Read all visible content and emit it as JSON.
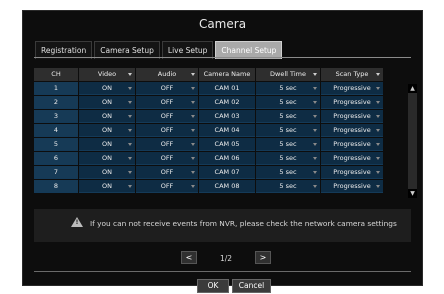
{
  "window": {
    "title": "Camera"
  },
  "tabs": [
    {
      "label": "Registration",
      "active": false
    },
    {
      "label": "Camera Setup",
      "active": false
    },
    {
      "label": "Live Setup",
      "active": false
    },
    {
      "label": "Channel Setup",
      "active": true
    }
  ],
  "table": {
    "headers": [
      "CH",
      "Video",
      "Audio",
      "Camera Name",
      "Dwell Time",
      "Scan Type"
    ],
    "rows": [
      {
        "ch": "1",
        "video": "ON",
        "audio": "OFF",
        "name": "CAM 01",
        "dwell": "5 sec",
        "scan": "Progressive"
      },
      {
        "ch": "2",
        "video": "ON",
        "audio": "OFF",
        "name": "CAM 02",
        "dwell": "5 sec",
        "scan": "Progressive"
      },
      {
        "ch": "3",
        "video": "ON",
        "audio": "OFF",
        "name": "CAM 03",
        "dwell": "5 sec",
        "scan": "Progressive"
      },
      {
        "ch": "4",
        "video": "ON",
        "audio": "OFF",
        "name": "CAM 04",
        "dwell": "5 sec",
        "scan": "Progressive"
      },
      {
        "ch": "5",
        "video": "ON",
        "audio": "OFF",
        "name": "CAM 05",
        "dwell": "5 sec",
        "scan": "Progressive"
      },
      {
        "ch": "6",
        "video": "ON",
        "audio": "OFF",
        "name": "CAM 06",
        "dwell": "5 sec",
        "scan": "Progressive"
      },
      {
        "ch": "7",
        "video": "ON",
        "audio": "OFF",
        "name": "CAM 07",
        "dwell": "5 sec",
        "scan": "Progressive"
      },
      {
        "ch": "8",
        "video": "ON",
        "audio": "OFF",
        "name": "CAM 08",
        "dwell": "5 sec",
        "scan": "Progressive"
      }
    ]
  },
  "notice": {
    "icon": "warning-icon",
    "text": "If you can not receive events from NVR, please check the network camera settings"
  },
  "pagination": {
    "prev": "<",
    "page": "1/2",
    "next": ">"
  },
  "buttons": {
    "ok": "OK",
    "cancel": "Cancel"
  },
  "colors": {
    "accent_tab": "#a9a9a9",
    "row_bg": "#0e2c44",
    "window_bg": "#0d0d0d"
  }
}
